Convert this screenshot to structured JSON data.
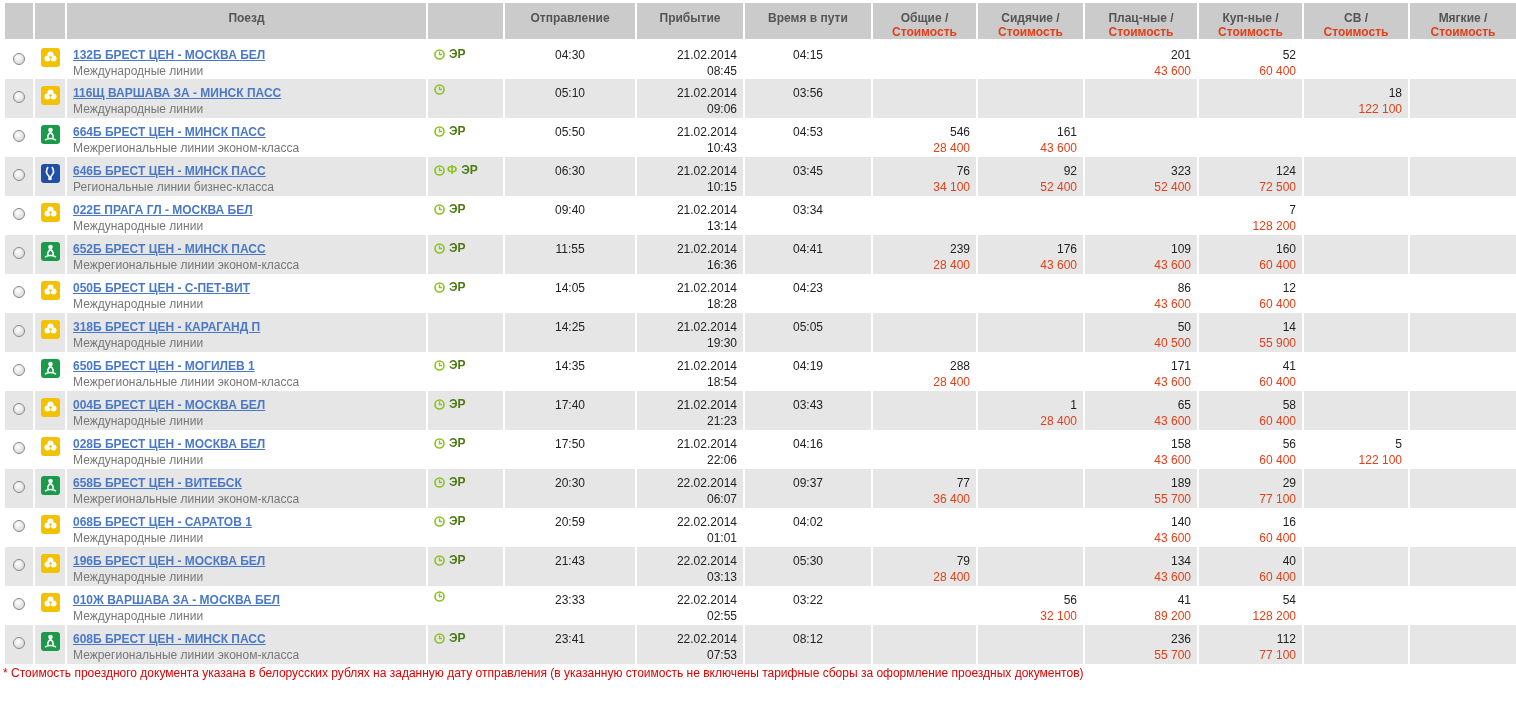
{
  "table": {
    "columns": [
      {
        "title": "Поезд"
      },
      {
        "title": "Отправление"
      },
      {
        "title": "Прибытие"
      },
      {
        "title": "Время в пути"
      }
    ],
    "seat_columns": [
      {
        "title": "Общие /",
        "subtitle": "Стоимость"
      },
      {
        "title": "Сидячие /",
        "subtitle": "Стоимость"
      },
      {
        "title": "Плац-ные /",
        "subtitle": "Стоимость"
      },
      {
        "title": "Куп-ные /",
        "subtitle": "Стоимость"
      },
      {
        "title": "СВ /",
        "subtitle": "Стоимость"
      },
      {
        "title": "Мягкие /",
        "subtitle": "Стоимость"
      }
    ],
    "rows": [
      {
        "selected": false,
        "kind": "international",
        "train": "132Б БРЕСТ ЦЕН - МОСКВА БЕЛ",
        "category": "Международные линии",
        "services": [
          {
            "kind": "clock"
          },
          {
            "kind": "label",
            "text": "ЭР"
          }
        ],
        "departure": "04:30",
        "arrival_date": "21.02.2014",
        "arrival_time": "08:45",
        "duration": "04:15",
        "seats": {
          "platskart": {
            "count": "201",
            "price": "43 600"
          },
          "kupe": {
            "count": "52",
            "price": "60 400"
          }
        }
      },
      {
        "selected": false,
        "kind": "international",
        "train": "116Щ ВАРШАВА ЗА - МИНСК ПАСС",
        "category": "Международные линии",
        "services": [
          {
            "kind": "clock"
          }
        ],
        "departure": "05:10",
        "arrival_date": "21.02.2014",
        "arrival_time": "09:06",
        "duration": "03:56",
        "seats": {
          "sv": {
            "count": "18",
            "price": "122 100"
          }
        }
      },
      {
        "selected": false,
        "kind": "interregional",
        "train": "664Б БРЕСТ ЦЕН - МИНСК ПАСС",
        "category": "Межрегиональные линии эконом-класса",
        "services": [
          {
            "kind": "clock"
          },
          {
            "kind": "label",
            "text": "ЭР"
          }
        ],
        "departure": "05:50",
        "arrival_date": "21.02.2014",
        "arrival_time": "10:43",
        "duration": "04:53",
        "seats": {
          "common": {
            "count": "546",
            "price": "28 400"
          },
          "seated": {
            "count": "161",
            "price": "43 600"
          }
        }
      },
      {
        "selected": false,
        "kind": "regional",
        "train": "646Б БРЕСТ ЦЕН - МИНСК ПАСС",
        "category": "Региональные линии бизнес-класса",
        "services": [
          {
            "kind": "clock"
          },
          {
            "kind": "mark",
            "text": "Ф"
          },
          {
            "kind": "label",
            "text": "ЭР"
          }
        ],
        "departure": "06:30",
        "arrival_date": "21.02.2014",
        "arrival_time": "10:15",
        "duration": "03:45",
        "seats": {
          "common": {
            "count": "76",
            "price": "34 100"
          },
          "seated": {
            "count": "92",
            "price": "52 400"
          },
          "platskart": {
            "count": "323",
            "price": "52 400"
          },
          "kupe": {
            "count": "124",
            "price": "72 500"
          }
        }
      },
      {
        "selected": false,
        "kind": "international",
        "train": "022Е ПРАГА ГЛ - МОСКВА БЕЛ",
        "category": "Международные линии",
        "services": [
          {
            "kind": "clock"
          },
          {
            "kind": "label",
            "text": "ЭР"
          }
        ],
        "departure": "09:40",
        "arrival_date": "21.02.2014",
        "arrival_time": "13:14",
        "duration": "03:34",
        "seats": {
          "kupe": {
            "count": "7",
            "price": "128 200"
          }
        }
      },
      {
        "selected": false,
        "kind": "interregional",
        "train": "652Б БРЕСТ ЦЕН - МИНСК ПАСС",
        "category": "Межрегиональные линии эконом-класса",
        "services": [
          {
            "kind": "clock"
          },
          {
            "kind": "label",
            "text": "ЭР"
          }
        ],
        "departure": "11:55",
        "arrival_date": "21.02.2014",
        "arrival_time": "16:36",
        "duration": "04:41",
        "seats": {
          "common": {
            "count": "239",
            "price": "28 400"
          },
          "seated": {
            "count": "176",
            "price": "43 600"
          },
          "platskart": {
            "count": "109",
            "price": "43 600"
          },
          "kupe": {
            "count": "160",
            "price": "60 400"
          }
        }
      },
      {
        "selected": false,
        "kind": "international",
        "train": "050Б БРЕСТ ЦЕН - С-ПЕТ-ВИТ",
        "category": "Международные линии",
        "services": [
          {
            "kind": "clock"
          },
          {
            "kind": "label",
            "text": "ЭР"
          }
        ],
        "departure": "14:05",
        "arrival_date": "21.02.2014",
        "arrival_time": "18:28",
        "duration": "04:23",
        "seats": {
          "platskart": {
            "count": "86",
            "price": "43 600"
          },
          "kupe": {
            "count": "12",
            "price": "60 400"
          }
        }
      },
      {
        "selected": false,
        "kind": "international",
        "train": "318Б БРЕСТ ЦЕН - КАРАГАНД П",
        "category": "Международные линии",
        "services": [],
        "departure": "14:25",
        "arrival_date": "21.02.2014",
        "arrival_time": "19:30",
        "duration": "05:05",
        "seats": {
          "platskart": {
            "count": "50",
            "price": "40 500"
          },
          "kupe": {
            "count": "14",
            "price": "55 900"
          }
        }
      },
      {
        "selected": false,
        "kind": "interregional",
        "train": "650Б БРЕСТ ЦЕН - МОГИЛЕВ 1",
        "category": "Межрегиональные линии эконом-класса",
        "services": [
          {
            "kind": "clock"
          },
          {
            "kind": "label",
            "text": "ЭР"
          }
        ],
        "departure": "14:35",
        "arrival_date": "21.02.2014",
        "arrival_time": "18:54",
        "duration": "04:19",
        "seats": {
          "common": {
            "count": "288",
            "price": "28 400"
          },
          "platskart": {
            "count": "171",
            "price": "43 600"
          },
          "kupe": {
            "count": "41",
            "price": "60 400"
          }
        }
      },
      {
        "selected": false,
        "kind": "international",
        "train": "004Б БРЕСТ ЦЕН - МОСКВА БЕЛ",
        "category": "Международные линии",
        "services": [
          {
            "kind": "clock"
          },
          {
            "kind": "label",
            "text": "ЭР"
          }
        ],
        "departure": "17:40",
        "arrival_date": "21.02.2014",
        "arrival_time": "21:23",
        "duration": "03:43",
        "seats": {
          "seated": {
            "count": "1",
            "price": "28 400"
          },
          "platskart": {
            "count": "65",
            "price": "43 600"
          },
          "kupe": {
            "count": "58",
            "price": "60 400"
          }
        }
      },
      {
        "selected": false,
        "kind": "international",
        "train": "028Б БРЕСТ ЦЕН - МОСКВА БЕЛ",
        "category": "Международные линии",
        "services": [
          {
            "kind": "clock"
          },
          {
            "kind": "label",
            "text": "ЭР"
          }
        ],
        "departure": "17:50",
        "arrival_date": "21.02.2014",
        "arrival_time": "22:06",
        "duration": "04:16",
        "seats": {
          "platskart": {
            "count": "158",
            "price": "43 600"
          },
          "kupe": {
            "count": "56",
            "price": "60 400"
          },
          "sv": {
            "count": "5",
            "price": "122 100"
          }
        }
      },
      {
        "selected": false,
        "kind": "interregional",
        "train": "658Б БРЕСТ ЦЕН - ВИТЕБСК",
        "category": "Межрегиональные линии эконом-класса",
        "services": [
          {
            "kind": "clock"
          },
          {
            "kind": "label",
            "text": "ЭР"
          }
        ],
        "departure": "20:30",
        "arrival_date": "22.02.2014",
        "arrival_time": "06:07",
        "duration": "09:37",
        "seats": {
          "common": {
            "count": "77",
            "price": "36 400"
          },
          "platskart": {
            "count": "189",
            "price": "55 700"
          },
          "kupe": {
            "count": "29",
            "price": "77 100"
          }
        }
      },
      {
        "selected": false,
        "kind": "international",
        "train": "068Б БРЕСТ ЦЕН - САРАТОВ 1",
        "category": "Международные линии",
        "services": [
          {
            "kind": "clock"
          },
          {
            "kind": "label",
            "text": "ЭР"
          }
        ],
        "departure": "20:59",
        "arrival_date": "22.02.2014",
        "arrival_time": "01:01",
        "duration": "04:02",
        "seats": {
          "platskart": {
            "count": "140",
            "price": "43 600"
          },
          "kupe": {
            "count": "16",
            "price": "60 400"
          }
        }
      },
      {
        "selected": false,
        "kind": "international",
        "train": "196Б БРЕСТ ЦЕН - МОСКВА БЕЛ",
        "category": "Международные линии",
        "services": [
          {
            "kind": "clock"
          },
          {
            "kind": "label",
            "text": "ЭР"
          }
        ],
        "departure": "21:43",
        "arrival_date": "22.02.2014",
        "arrival_time": "03:13",
        "duration": "05:30",
        "seats": {
          "common": {
            "count": "79",
            "price": "28 400"
          },
          "platskart": {
            "count": "134",
            "price": "43 600"
          },
          "kupe": {
            "count": "40",
            "price": "60 400"
          }
        }
      },
      {
        "selected": false,
        "kind": "international",
        "train": "010Ж ВАРШАВА ЗА - МОСКВА БЕЛ",
        "category": "Международные линии",
        "services": [
          {
            "kind": "clock"
          }
        ],
        "departure": "23:33",
        "arrival_date": "22.02.2014",
        "arrival_time": "02:55",
        "duration": "03:22",
        "seats": {
          "seated": {
            "count": "56",
            "price": "32 100"
          },
          "platskart": {
            "count": "41",
            "price": "89 200"
          },
          "kupe": {
            "count": "54",
            "price": "128 200"
          }
        }
      },
      {
        "selected": false,
        "kind": "interregional",
        "train": "608Б БРЕСТ ЦЕН - МИНСК ПАСС",
        "category": "Межрегиональные линии эконом-класса",
        "services": [
          {
            "kind": "clock"
          },
          {
            "kind": "label",
            "text": "ЭР"
          }
        ],
        "departure": "23:41",
        "arrival_date": "22.02.2014",
        "arrival_time": "07:53",
        "duration": "08:12",
        "seats": {
          "platskart": {
            "count": "236",
            "price": "55 700"
          },
          "kupe": {
            "count": "112",
            "price": "77 100"
          }
        }
      }
    ]
  },
  "footnote": "* Стоимость проездного документа указана в белорусских рублях на заданную дату отправления (в указанную стоимость не включены тарифные сборы за оформление проездных документов)"
}
